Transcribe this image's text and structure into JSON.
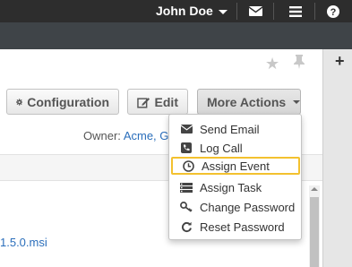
{
  "topbar": {
    "user_name": "John Doe",
    "icons": [
      "envelope-icon",
      "menu-icon",
      "help-icon"
    ],
    "help_glyph": "?"
  },
  "panel": {
    "buttons": {
      "configuration": "Configuration",
      "edit": "Edit",
      "more_actions": "More Actions"
    },
    "owner_label": "Owner:",
    "owner_value": "Acme, G",
    "file_link": "1.5.0.msi",
    "add_glyph": "+"
  },
  "menu": {
    "items": [
      {
        "label": "Send Email",
        "icon": "envelope-icon"
      },
      {
        "label": "Log Call",
        "icon": "phone-icon"
      },
      {
        "label": "Assign Event",
        "icon": "clock-icon",
        "highlighted": true
      },
      {
        "label": "Assign Task",
        "icon": "task-list-icon"
      },
      {
        "label": "Change Password",
        "icon": "key-icon"
      },
      {
        "label": "Reset Password",
        "icon": "refresh-icon"
      }
    ]
  },
  "colors": {
    "topbar": "#2d2d2d",
    "subbar": "#3f4448",
    "link": "#2a6ebb",
    "highlight_border": "#f3c12f"
  }
}
